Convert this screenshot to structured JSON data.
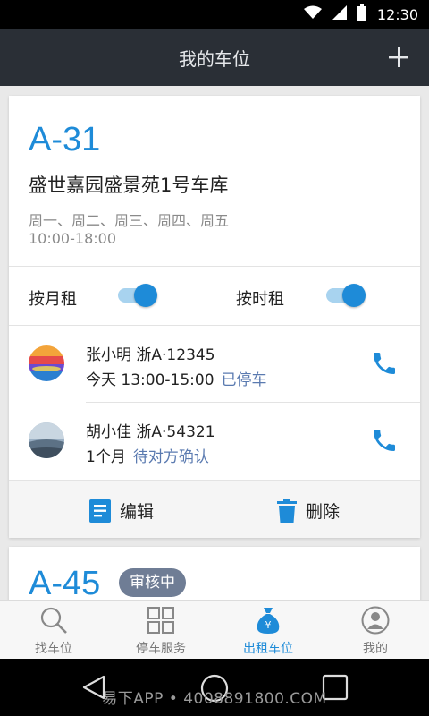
{
  "status_bar": {
    "time": "12:30"
  },
  "app_bar": {
    "title": "我的车位",
    "add_label": "+"
  },
  "spots": [
    {
      "code": "A-31",
      "name": "盛世嘉园盛景苑1号车库",
      "days": "周一、周二、周三、周四、周五",
      "hours": "10:00-18:00",
      "monthly_label": "按月租",
      "monthly_enabled": true,
      "hourly_label": "按时租",
      "hourly_enabled": true,
      "renters": [
        {
          "name_plate": "张小明  浙A·12345",
          "time": "今天 13:00-15:00",
          "status": "已停车"
        },
        {
          "name_plate": "胡小佳  浙A·54321",
          "time": "1个月",
          "status": "待对方确认"
        }
      ],
      "edit_label": "编辑",
      "delete_label": "删除"
    },
    {
      "code": "A-45",
      "badge": "审核中"
    }
  ],
  "tabs": [
    {
      "label": "找车位",
      "icon": "search-icon",
      "active": false
    },
    {
      "label": "停车服务",
      "icon": "grid-icon",
      "active": false
    },
    {
      "label": "出租车位",
      "icon": "money-bag-icon",
      "active": true
    },
    {
      "label": "我的",
      "icon": "user-icon",
      "active": false
    }
  ],
  "watermark": "易下APP • 4008891800.COM",
  "colors": {
    "accent": "#1e8bd8",
    "app_bar": "#2a2f36",
    "status_text": "#5a7ab0",
    "badge": "#6f7d95"
  }
}
